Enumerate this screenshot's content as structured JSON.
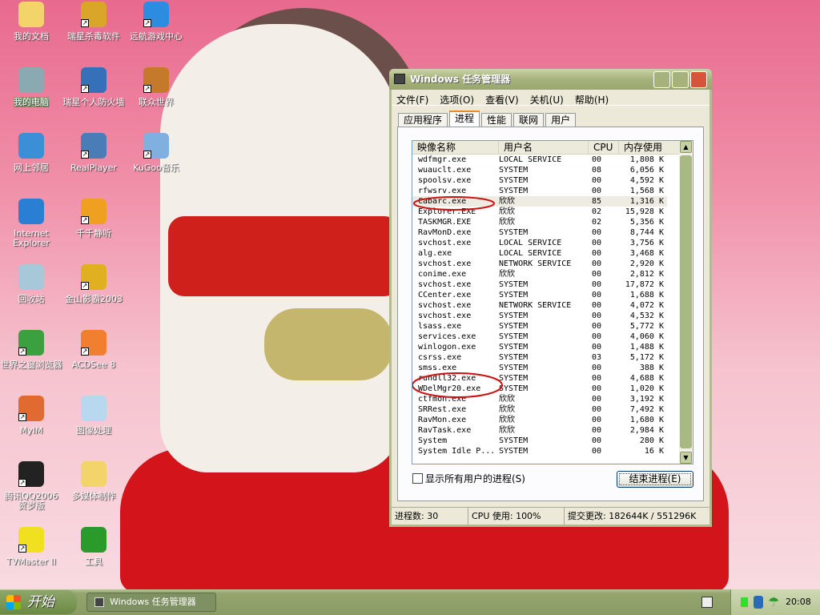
{
  "desktop": {
    "icons": [
      {
        "label": "我的文档",
        "color": "#f2d46b",
        "shortcut": false,
        "icon": "folder-icon"
      },
      {
        "label": "瑞星杀毒软件",
        "color": "#d9a62a",
        "shortcut": true,
        "icon": "lion-shield-icon"
      },
      {
        "label": "远航游戏中心",
        "color": "#2c8de0",
        "shortcut": true,
        "icon": "dolphin-icon"
      },
      {
        "label": "我的电脑",
        "color": "#88aab0",
        "shortcut": false,
        "icon": "computer-icon",
        "selected": true
      },
      {
        "label": "瑞星个人防火墙",
        "color": "#3670b8",
        "shortcut": true,
        "icon": "firewall-icon"
      },
      {
        "label": "联众世界",
        "color": "#c47a2a",
        "shortcut": true,
        "icon": "house-icon"
      },
      {
        "label": "网上邻居",
        "color": "#3a8fd6",
        "shortcut": false,
        "icon": "network-icon"
      },
      {
        "label": "RealPlayer",
        "color": "#4a7cb8",
        "shortcut": true,
        "icon": "realplayer-icon"
      },
      {
        "label": "KuGoo音乐",
        "color": "#7fb0e0",
        "shortcut": true,
        "icon": "kugoo-icon"
      },
      {
        "label": "Internet Explorer",
        "color": "#2a7fd4",
        "shortcut": false,
        "icon": "ie-icon"
      },
      {
        "label": "千千静听",
        "color": "#f0a020",
        "shortcut": true,
        "icon": "headphones-icon"
      },
      null,
      {
        "label": "回收站",
        "color": "#a6c8d8",
        "shortcut": false,
        "icon": "recycle-bin-icon"
      },
      {
        "label": "金山影霸2003",
        "color": "#e0b020",
        "shortcut": true,
        "icon": "film-icon"
      },
      null,
      {
        "label": "世界之窗浏览器",
        "color": "#3aa040",
        "shortcut": true,
        "icon": "browser-icon"
      },
      {
        "label": "ACDSee 8",
        "color": "#f08030",
        "shortcut": true,
        "icon": "acdsee-icon"
      },
      null,
      {
        "label": "MyIM",
        "color": "#e06a30",
        "shortcut": true,
        "icon": "pinwheel-icon"
      },
      {
        "label": "图像处理",
        "color": "#b8d8f0",
        "shortcut": false,
        "icon": "image-file-icon"
      },
      null,
      {
        "label": "腾讯QQ2006贺岁版",
        "color": "#222222",
        "shortcut": true,
        "icon": "qq-penguin-icon"
      },
      {
        "label": "多媒体制作",
        "color": "#f2d46b",
        "shortcut": false,
        "icon": "media-folder-icon"
      },
      null,
      {
        "label": "TVMaster II",
        "color": "#f0e020",
        "shortcut": true,
        "icon": "tvmaster-icon"
      },
      {
        "label": "工具",
        "color": "#2a9a2a",
        "shortcut": false,
        "icon": "tree-icon"
      }
    ]
  },
  "window": {
    "title": "Windows 任务管理器",
    "menu": [
      "文件(F)",
      "选项(O)",
      "查看(V)",
      "关机(U)",
      "帮助(H)"
    ],
    "tabs": [
      "应用程序",
      "进程",
      "性能",
      "联网",
      "用户"
    ],
    "active_tab": 1,
    "columns": [
      "映像名称",
      "用户名",
      "CPU",
      "内存使用"
    ],
    "processes": [
      [
        "wdfmgr.exe",
        "LOCAL SERVICE",
        "00",
        "1,808 K"
      ],
      [
        "wuauclt.exe",
        "SYSTEM",
        "08",
        "6,056 K"
      ],
      [
        "spoolsv.exe",
        "SYSTEM",
        "00",
        "4,592 K"
      ],
      [
        "rfwsrv.exe",
        "SYSTEM",
        "00",
        "1,568 K"
      ],
      [
        "Cabarc.exe",
        "欣欣",
        "85",
        "1,316 K"
      ],
      [
        "Explorer.EXE",
        "欣欣",
        "02",
        "15,928 K"
      ],
      [
        "TASKMGR.EXE",
        "欣欣",
        "02",
        "5,356 K"
      ],
      [
        "RavMonD.exe",
        "SYSTEM",
        "00",
        "8,744 K"
      ],
      [
        "svchost.exe",
        "LOCAL SERVICE",
        "00",
        "3,756 K"
      ],
      [
        "alg.exe",
        "LOCAL SERVICE",
        "00",
        "3,468 K"
      ],
      [
        "svchost.exe",
        "NETWORK SERVICE",
        "00",
        "2,920 K"
      ],
      [
        "conime.exe",
        "欣欣",
        "00",
        "2,812 K"
      ],
      [
        "svchost.exe",
        "SYSTEM",
        "00",
        "17,872 K"
      ],
      [
        "CCenter.exe",
        "SYSTEM",
        "00",
        "1,688 K"
      ],
      [
        "svchost.exe",
        "NETWORK SERVICE",
        "00",
        "4,072 K"
      ],
      [
        "svchost.exe",
        "SYSTEM",
        "00",
        "4,532 K"
      ],
      [
        "lsass.exe",
        "SYSTEM",
        "00",
        "5,772 K"
      ],
      [
        "services.exe",
        "SYSTEM",
        "00",
        "4,060 K"
      ],
      [
        "winlogon.exe",
        "SYSTEM",
        "00",
        "1,488 K"
      ],
      [
        "csrss.exe",
        "SYSTEM",
        "03",
        "5,172 K"
      ],
      [
        "smss.exe",
        "SYSTEM",
        "00",
        "388 K"
      ],
      [
        "rundll32.exe",
        "SYSTEM",
        "00",
        "4,688 K"
      ],
      [
        "WDelMgr20.exe",
        "SYSTEM",
        "00",
        "1,020 K"
      ],
      [
        "ctfmon.exe",
        "欣欣",
        "00",
        "3,192 K"
      ],
      [
        "SRRest.exe",
        "欣欣",
        "00",
        "7,492 K"
      ],
      [
        "RavMon.exe",
        "欣欣",
        "00",
        "1,680 K"
      ],
      [
        "RavTask.exe",
        "欣欣",
        "00",
        "2,984 K"
      ],
      [
        "System",
        "SYSTEM",
        "00",
        "280 K"
      ],
      [
        "System Idle P...",
        "SYSTEM",
        "00",
        "16 K"
      ]
    ],
    "selected_row": 4,
    "show_all_users": "显示所有用户的进程(S)",
    "end_process": "结束进程(E)",
    "status": {
      "processes": "进程数: 30",
      "cpu": "CPU 使用: 100%",
      "commit": "提交更改: 182644K / 551296K"
    }
  },
  "taskbar": {
    "start": "开始",
    "task": "Windows 任务管理器",
    "clock": "20:08"
  },
  "colors": {
    "annotation": "#cc1010",
    "taskbar": "#8a9b64"
  }
}
